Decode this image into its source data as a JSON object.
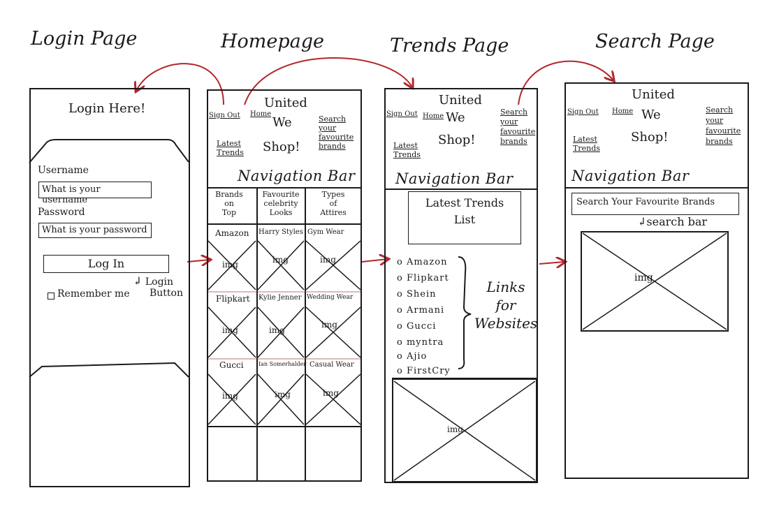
{
  "pages": {
    "login_title": "Login Page",
    "home_title": "Homepage",
    "trends_title": "Trends Page",
    "search_title": "Search Page"
  },
  "login": {
    "heading": "Login Here!",
    "username_label": "Username",
    "username_placeholder": "What is your username",
    "password_label": "Password",
    "password_placeholder": "What is your password",
    "login_button": "Log In",
    "login_note_1": "Login",
    "login_note_2": "Button",
    "remember": "Remember me"
  },
  "header": {
    "brand_1": "United",
    "brand_2": "We",
    "brand_3": "Shop!",
    "sign_out": "Sign Out",
    "home": "Home",
    "latest_1": "Latest",
    "latest_2": "Trends",
    "search_1": "Search",
    "search_2": "your",
    "search_3": "favourite",
    "search_4": "brands",
    "navbar": "Navigation Bar"
  },
  "home": {
    "col_1": [
      "Brands",
      "on",
      "Top"
    ],
    "col_2": [
      "Favourite",
      "celebrity",
      "Looks"
    ],
    "col_3": [
      "Types",
      "of",
      "Attires"
    ],
    "rows": [
      [
        "Amazon",
        "Harry Styles",
        "Gym Wear"
      ],
      [
        "Flipkart",
        "Kylie Jenner",
        "Wedding Wear"
      ],
      [
        "Gucci",
        "Ian Somerhalder",
        "Casual Wear"
      ]
    ],
    "img": "img"
  },
  "trends": {
    "list_title_1": "Latest Trends",
    "list_title_2": "List",
    "links": [
      "Amazon",
      "Flipkart",
      "Shein",
      "Armani",
      "Gucci",
      "myntra",
      "Ajio",
      "FirstCry"
    ],
    "links_note_1": "Links",
    "links_note_2": "for",
    "links_note_3": "Websites",
    "img": "img"
  },
  "search": {
    "bar_text": "Search Your Favourite Brands",
    "bar_note": "search bar",
    "img": "img"
  }
}
